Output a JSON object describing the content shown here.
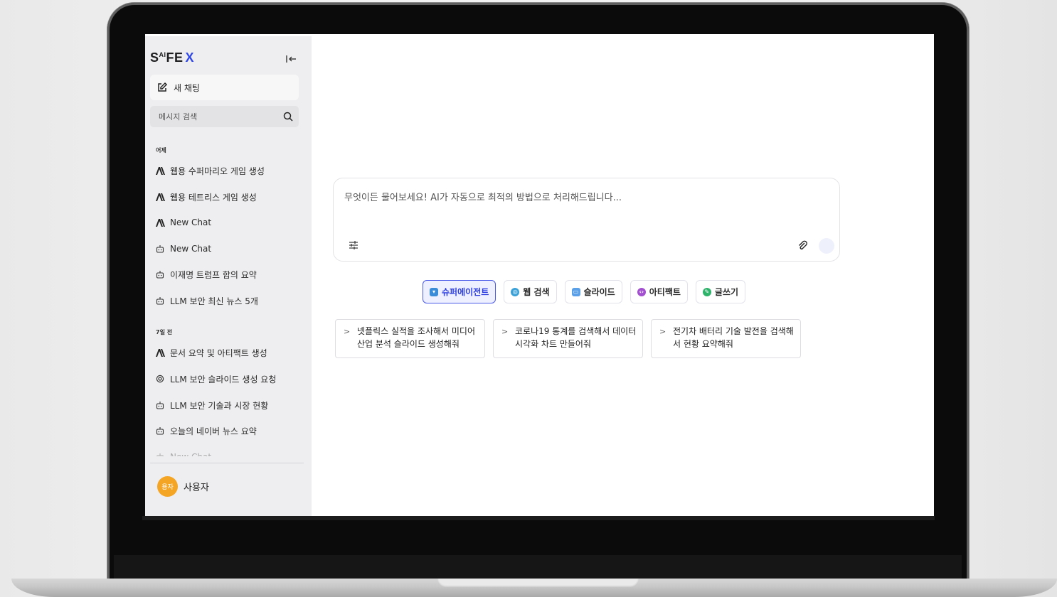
{
  "brand": {
    "logo_prefix": "S",
    "logo_sup": "AI",
    "logo_mid": "FE",
    "logo_x": "X",
    "accent": "#2f46e8"
  },
  "sidebar": {
    "collapse_icon": "collapse-left-icon",
    "new_chat_label": "새 채팅",
    "search_placeholder": "메시지 검색",
    "sections": [
      {
        "label": "어제",
        "items": [
          {
            "label": "웹용 수퍼마리오 게임 생성",
            "icon": "agent-icon"
          },
          {
            "label": "웹용 테트리스 게임 생성",
            "icon": "agent-icon"
          },
          {
            "label": "New Chat",
            "icon": "agent-icon"
          },
          {
            "label": "New Chat",
            "icon": "bot-icon"
          },
          {
            "label": "이재명 트럼프 합의 요약",
            "icon": "bot-icon"
          },
          {
            "label": "LLM 보안 최신 뉴스 5개",
            "icon": "bot-icon"
          }
        ]
      },
      {
        "label": "7일 전",
        "items": [
          {
            "label": "문서 요약 및 아티팩트 생성",
            "icon": "agent-icon"
          },
          {
            "label": "LLM 보안 슬라이드 생성 요청",
            "icon": "openai-icon"
          },
          {
            "label": "LLM 보안 기술과 시장 현황",
            "icon": "bot-icon"
          },
          {
            "label": "오늘의 네이버 뉴스 요약",
            "icon": "bot-icon"
          },
          {
            "label": "New Chat",
            "icon": "bot-icon"
          }
        ]
      }
    ],
    "user": {
      "avatar_text": "용자",
      "name": "사용자",
      "avatar_color": "#f5a524"
    }
  },
  "composer": {
    "placeholder": "무엇이든 물어보세요! AI가 자동으로 최적의 방법으로 처리해드립니다..."
  },
  "modes": [
    {
      "label": "슈퍼에이전트",
      "icon": "agent-bowl-icon",
      "active": true,
      "color": "#3a8bd8"
    },
    {
      "label": "웹 검색",
      "icon": "globe-icon",
      "active": false,
      "color": "#3aa0d8"
    },
    {
      "label": "슬라이드",
      "icon": "slide-icon",
      "active": false,
      "color": "#5aa0e8"
    },
    {
      "label": "아티팩트",
      "icon": "code-icon",
      "active": false,
      "color": "#a24fd0"
    },
    {
      "label": "글쓰기",
      "icon": "write-icon",
      "active": false,
      "color": "#2fb36b"
    }
  ],
  "suggestions": [
    {
      "text": "넷플릭스 실적을 조사해서 미디어 산업 분석 슬라이드 생성해줘"
    },
    {
      "text": "코로나19 통계를 검색해서 데이터 시각화 차트 만들어줘"
    },
    {
      "text": "전기차 배터리 기술 발전을 검색해서 현황 요약해줘"
    }
  ]
}
